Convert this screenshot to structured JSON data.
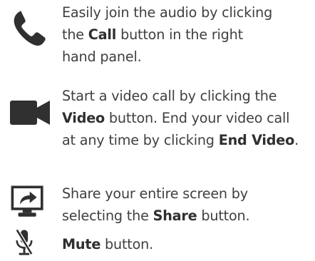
{
  "colors": {
    "icon": "#303030",
    "text": "#3f3f3f"
  },
  "items": [
    {
      "icon": "phone-icon",
      "lines": [
        [
          "Easily join the audio by clicking"
        ],
        [
          "the ",
          {
            "b": "Call"
          },
          " button in the right"
        ],
        [
          "hand panel."
        ]
      ]
    },
    {
      "icon": "video-camera-icon",
      "lines": [
        [
          "Start a video call by clicking the"
        ],
        [
          {
            "b": "Video"
          },
          " button. End your video call"
        ],
        [
          "at any time by clicking ",
          {
            "b": "End Video"
          },
          "."
        ]
      ]
    },
    {
      "icon": "share-screen-icon",
      "lines": [
        [
          "Share your entire screen by"
        ],
        [
          "selecting the ",
          {
            "b": "Share"
          },
          " button."
        ]
      ]
    },
    {
      "icon": "microphone-muted-icon",
      "lines": [
        [
          {
            "b": "Mute"
          },
          " button."
        ]
      ]
    }
  ]
}
